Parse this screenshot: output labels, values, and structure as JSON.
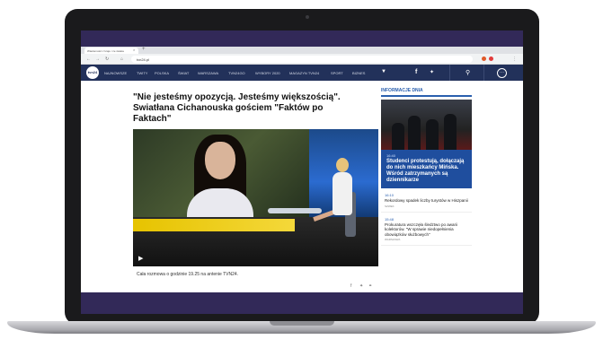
{
  "browser": {
    "tab_title": "Wiadomości z kraju i ze świata",
    "url": "tvn24.pl"
  },
  "site": {
    "logo": "tvn24",
    "nav": [
      "NAJNOWSZE",
      "TWITY",
      "POLSKA",
      "ŚWIAT",
      "WARSZAWA",
      "TVN24GO",
      "WYBORY 2020",
      "MAGAZYN TVN24",
      "SPORT",
      "BIZNES"
    ],
    "brand_color": "#22315a"
  },
  "article": {
    "headline": "\"Nie jesteśmy opozycją. Jesteśmy większością\". Swiatłana Cichanouska gościem \"Faktów po Faktach\"",
    "caption": "Cała rozmowa o godzinie 19.25 na antenie TVN24."
  },
  "sidebar": {
    "title": "INFORMACJE DNIA",
    "feature": {
      "time": "16:40",
      "title": "Studenci protestują, dołączają do nich mieszkańcy Mińska. Wśród zatrzymanych są dziennikarze"
    },
    "items": [
      {
        "time": "16:10",
        "title": "Rekordowy spadek liczby turystów w Hiszpanii",
        "source": "SZWEK"
      },
      {
        "time": "15:48",
        "title": "Prokuratura wszczęła śledztwo po awarii kolektorów. \"W sprawie niedopełnienia obowiązków służbowych\"",
        "source": "WARSZAWA"
      }
    ]
  }
}
